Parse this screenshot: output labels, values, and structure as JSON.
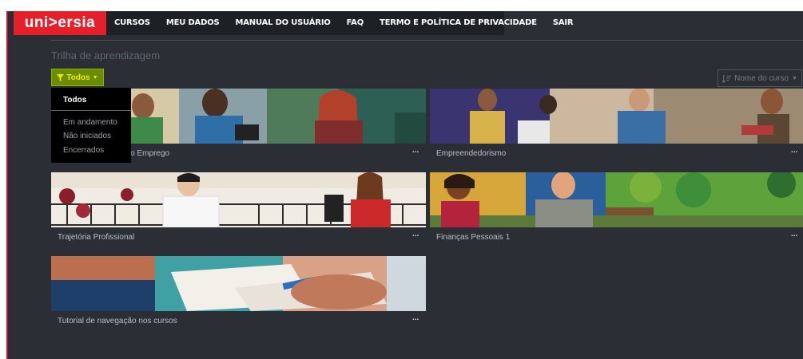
{
  "brand": {
    "logo_text": "uni>ersia",
    "accent": "#e4202a"
  },
  "nav": {
    "items": [
      {
        "label": "CURSOS"
      },
      {
        "label": "MEU DADOS"
      },
      {
        "label": "MANUAL DO USUÁRIO"
      },
      {
        "label": "FAQ"
      },
      {
        "label": "TERMO E POLÍTICA DE PRIVACIDADE"
      },
      {
        "label": "SAIR"
      }
    ]
  },
  "page": {
    "title": "Trilha de aprendizagem"
  },
  "filter": {
    "label": "Todos",
    "icon": "filter-icon",
    "options": [
      {
        "label": "Todos",
        "active": true
      },
      {
        "label": "Em andamento"
      },
      {
        "label": "Não iniciados"
      },
      {
        "label": "Encerrados"
      }
    ]
  },
  "sort": {
    "label": "Nome do curso",
    "icon": "sort-icon"
  },
  "courses": [
    {
      "name": "Conectando um Novo Emprego",
      "more": "..."
    },
    {
      "name": "Empreendedorismo",
      "more": "..."
    },
    {
      "name": "Trajetória Profissional",
      "more": "..."
    },
    {
      "name": "Finanças Pessoais 1",
      "more": "..."
    },
    {
      "name": "Tutorial de navegação nos cursos",
      "more": "..."
    }
  ],
  "colors": {
    "background": "#2b2f35",
    "navbar": "#1d2024",
    "filter_button": "#6a8c00",
    "filter_text": "#f2e600"
  }
}
